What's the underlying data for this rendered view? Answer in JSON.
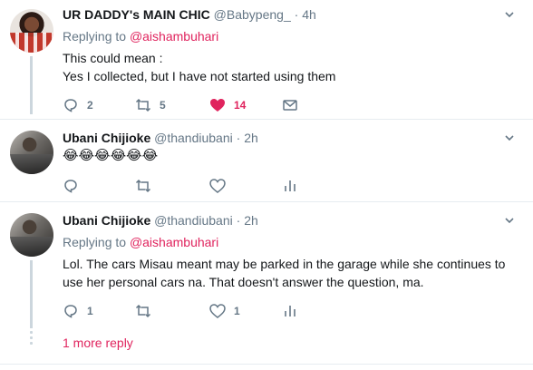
{
  "tweets": [
    {
      "name": "UR DADDY's MAIN CHIC",
      "handle": "@Babypeng_",
      "sep": "·",
      "time": "4h",
      "replying_prefix": "Replying to",
      "replying_to": "@aishambuhari",
      "lines": [
        "This could mean :",
        "Yes I collected,  but I have not started using them"
      ],
      "reply_count": "2",
      "retweet_count": "5",
      "like_count": "14",
      "liked": true
    },
    {
      "name": "Ubani Chijioke",
      "handle": "@thandiubani",
      "sep": "·",
      "time": "2h",
      "emoji": "😂😂😂😂😂😂",
      "reply_count": "",
      "retweet_count": "",
      "like_count": ""
    },
    {
      "name": "Ubani Chijioke",
      "handle": "@thandiubani",
      "sep": "·",
      "time": "2h",
      "replying_prefix": "Replying to",
      "replying_to": "@aishambuhari",
      "lines": [
        "Lol. The cars Misau meant may be parked in the garage while she continues to",
        "use her personal cars na. That doesn't answer the question, ma."
      ],
      "reply_count": "1",
      "retweet_count": "",
      "like_count": "1"
    }
  ],
  "more_replies": "1 more reply",
  "icons": {
    "reply": "reply-icon",
    "retweet": "retweet-icon",
    "like": "heart-icon",
    "dm": "envelope-icon",
    "analytics": "analytics-icon",
    "more": "chevron-down-icon"
  },
  "colors": {
    "accent": "#e0245e",
    "muted": "#657786",
    "divider": "#e6ecf0",
    "thread": "#ccd6dd"
  }
}
